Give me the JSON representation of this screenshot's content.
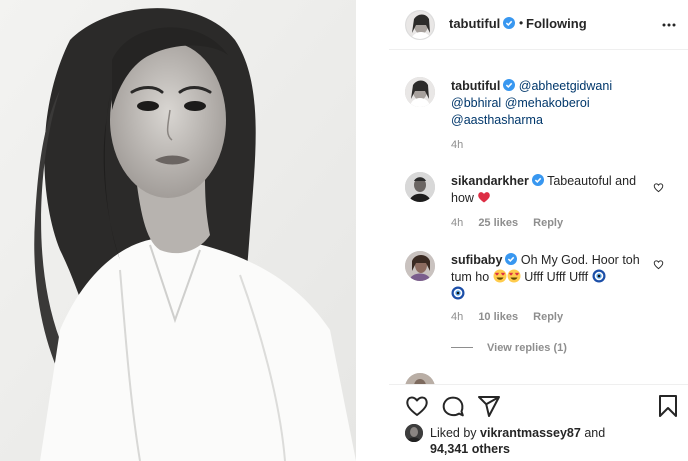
{
  "header": {
    "username": "tabutiful",
    "separator": "•",
    "follow_status": "Following"
  },
  "caption": {
    "username": "tabutiful",
    "mentions": [
      "@abheetgidwani",
      "@bbhiral",
      "@mehakoberoi",
      "@aasthasharma"
    ],
    "time": "4h"
  },
  "comments": [
    {
      "username": "sikandarkher",
      "text_line1": "Tabeautoful and",
      "text_line2": "how",
      "emoji": [
        "red-heart"
      ],
      "time": "4h",
      "likes": "25 likes",
      "reply": "Reply"
    },
    {
      "username": "sufibaby",
      "text_line1": "Oh My God. Hoor toh",
      "text_line2a": "tum ho",
      "text_line2b": "Ufff Ufff Ufff",
      "emoji": [
        "heart-eyes",
        "heart-eyes",
        "nazar-amulet",
        "nazar-amulet"
      ],
      "time": "4h",
      "likes": "10 likes",
      "reply": "Reply"
    }
  ],
  "view_replies": "View replies (1)",
  "liked_by": {
    "prefix": "Liked by",
    "user": "vikrantmassey87",
    "and": "and",
    "count": "94,341 others"
  },
  "icons": [
    "verified-badge",
    "more-options-icon",
    "like-icon",
    "comment-icon",
    "share-icon",
    "save-icon"
  ],
  "colors": {
    "verified": "#3897f0",
    "mention": "#00376b",
    "muted": "#8e8e8e",
    "heart": "#ed4956"
  }
}
